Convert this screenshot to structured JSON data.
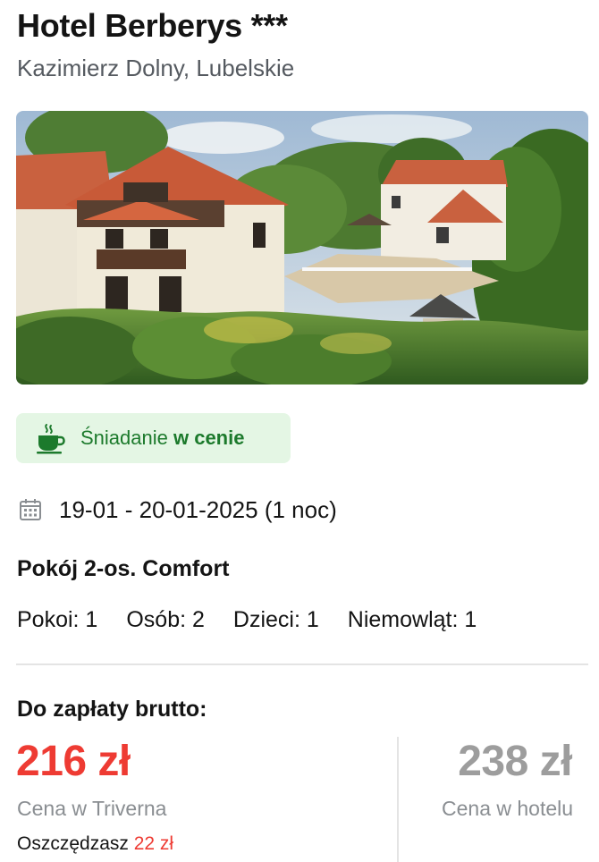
{
  "hotel": {
    "name": "Hotel Berberys ***",
    "location": "Kazimierz Dolny, Lubelskie"
  },
  "photo": {
    "icon": "hotel-photo"
  },
  "breakfast": {
    "icon": "coffee-cup-icon",
    "text_prefix": "Śniadanie ",
    "text_emphasis": "w cenie",
    "color": "#1c7a2c",
    "background": "#e4f6e4"
  },
  "stay": {
    "icon": "calendar-icon",
    "dates": "19-01 - 20-01-2025 (1 noc)"
  },
  "room": {
    "name": "Pokój 2-os. Comfort"
  },
  "occupancy": [
    "Pokoi: 1",
    "Osób: 2",
    "Dzieci: 1",
    "Niemowląt: 1"
  ],
  "payment": {
    "label": "Do zapłaty brutto:",
    "price": "216 zł",
    "price_caption": "Cena w Triverna",
    "savings_prefix": "Oszczędzasz ",
    "savings_amount": "22 zł",
    "hotel_price": "238 zł",
    "hotel_price_caption": "Cena w hotelu",
    "accent_color": "#ee3b33"
  }
}
